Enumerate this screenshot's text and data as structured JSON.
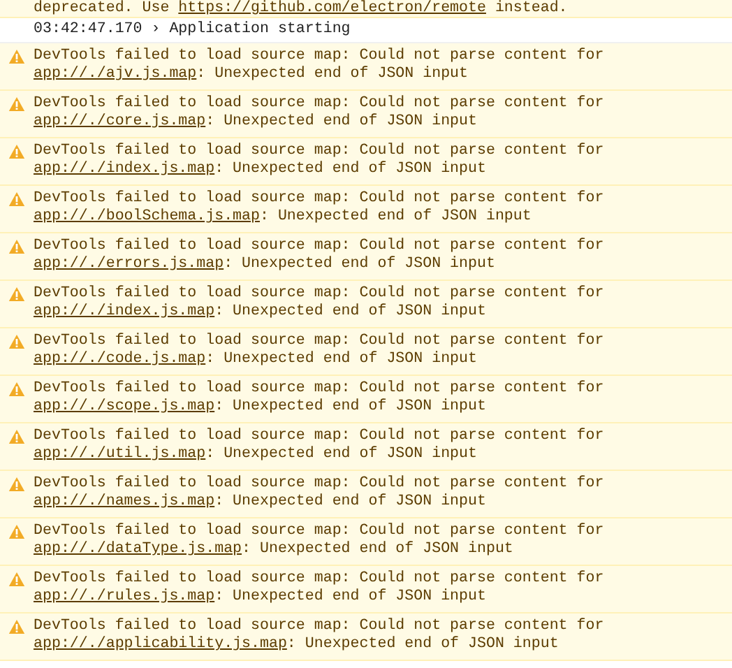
{
  "messages": [
    {
      "kind": "warning",
      "icon": false,
      "text": "deprecated. Use ",
      "link": "https://github.com/electron/remote",
      "after": " instead."
    },
    {
      "kind": "info",
      "icon": false,
      "text": "03:42:47.170 › Application starting"
    },
    {
      "kind": "warning",
      "icon": true,
      "text": "DevTools failed to load source map: Could not parse content for ",
      "link": "app://./ajv.js.map",
      "after": ": Unexpected end of JSON input"
    },
    {
      "kind": "warning",
      "icon": true,
      "text": "DevTools failed to load source map: Could not parse content for ",
      "link": "app://./core.js.map",
      "after": ": Unexpected end of JSON input"
    },
    {
      "kind": "warning",
      "icon": true,
      "text": "DevTools failed to load source map: Could not parse content for ",
      "link": "app://./index.js.map",
      "after": ": Unexpected end of JSON input"
    },
    {
      "kind": "warning",
      "icon": true,
      "text": "DevTools failed to load source map: Could not parse content for ",
      "link": "app://./boolSchema.js.map",
      "after": ": Unexpected end of JSON input"
    },
    {
      "kind": "warning",
      "icon": true,
      "text": "DevTools failed to load source map: Could not parse content for ",
      "link": "app://./errors.js.map",
      "after": ": Unexpected end of JSON input"
    },
    {
      "kind": "warning",
      "icon": true,
      "text": "DevTools failed to load source map: Could not parse content for ",
      "link": "app://./index.js.map",
      "after": ": Unexpected end of JSON input"
    },
    {
      "kind": "warning",
      "icon": true,
      "text": "DevTools failed to load source map: Could not parse content for ",
      "link": "app://./code.js.map",
      "after": ": Unexpected end of JSON input"
    },
    {
      "kind": "warning",
      "icon": true,
      "text": "DevTools failed to load source map: Could not parse content for ",
      "link": "app://./scope.js.map",
      "after": ": Unexpected end of JSON input"
    },
    {
      "kind": "warning",
      "icon": true,
      "text": "DevTools failed to load source map: Could not parse content for ",
      "link": "app://./util.js.map",
      "after": ": Unexpected end of JSON input"
    },
    {
      "kind": "warning",
      "icon": true,
      "text": "DevTools failed to load source map: Could not parse content for ",
      "link": "app://./names.js.map",
      "after": ": Unexpected end of JSON input"
    },
    {
      "kind": "warning",
      "icon": true,
      "text": "DevTools failed to load source map: Could not parse content for ",
      "link": "app://./dataType.js.map",
      "after": ": Unexpected end of JSON input"
    },
    {
      "kind": "warning",
      "icon": true,
      "text": "DevTools failed to load source map: Could not parse content for ",
      "link": "app://./rules.js.map",
      "after": ": Unexpected end of JSON input"
    },
    {
      "kind": "warning",
      "icon": true,
      "text": "DevTools failed to load source map: Could not parse content for ",
      "link": "app://./applicability.js.map",
      "after": ": Unexpected end of JSON input"
    }
  ]
}
